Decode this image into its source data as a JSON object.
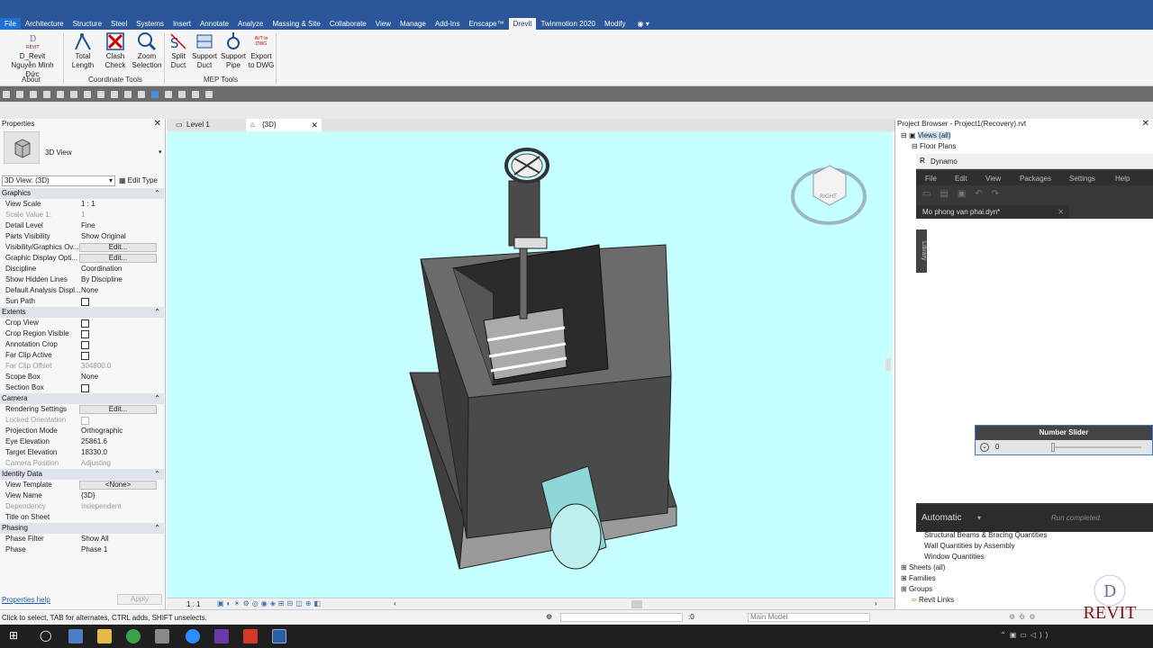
{
  "menu": {
    "tabs": [
      "File",
      "Architecture",
      "Structure",
      "Steel",
      "Systems",
      "Insert",
      "Annotate",
      "Analyze",
      "Massing & Site",
      "Collaborate",
      "View",
      "Manage",
      "Add-Ins",
      "Enscape™",
      "Drevit",
      "Twinmotion 2020",
      "Modify"
    ]
  },
  "ribbon": {
    "about": {
      "top": "D_Revit",
      "name": "Nguyễn Minh Đức",
      "panel": "About"
    },
    "coord": {
      "total_length": [
        "Total",
        "Length"
      ],
      "clash_check": [
        "Clash",
        "Check"
      ],
      "zoom_selection": [
        "Zoom",
        "Selection"
      ],
      "panel": "Coordinate Tools"
    },
    "mep": {
      "split_duct": [
        "Split",
        "Duct"
      ],
      "support_duct": [
        "Support",
        "Duct"
      ],
      "support_pipe": [
        "Support",
        "Pipe"
      ],
      "export_dwg": [
        "Export",
        "to DWG"
      ],
      "export_icon_text": "AVT to DWG",
      "panel": "MEP Tools"
    }
  },
  "properties": {
    "title": "Properties",
    "type_name": "3D View",
    "selector": "3D View: (3D)",
    "edit_type": "Edit Type",
    "groups": {
      "graphics": "Graphics",
      "extents": "Extents",
      "camera": "Camera",
      "identity": "Identity Data",
      "phasing": "Phasing"
    },
    "rows": {
      "view_scale": [
        "View Scale",
        "1 : 1"
      ],
      "scale_value": [
        "Scale Value    1:",
        "1"
      ],
      "detail_level": [
        "Detail Level",
        "Fine"
      ],
      "parts_visibility": [
        "Parts Visibility",
        "Show Original"
      ],
      "vg": [
        "Visibility/Graphics Ov...",
        "Edit..."
      ],
      "gdo": [
        "Graphic Display Opti...",
        "Edit..."
      ],
      "discipline": [
        "Discipline",
        "Coordination"
      ],
      "hidden_lines": [
        "Show Hidden Lines",
        "By Discipline"
      ],
      "analysis": [
        "Default Analysis Displ...",
        "None"
      ],
      "sun_path": [
        "Sun Path",
        ""
      ],
      "crop_view": [
        "Crop View",
        ""
      ],
      "crop_region": [
        "Crop Region Visible",
        ""
      ],
      "anno_crop": [
        "Annotation Crop",
        ""
      ],
      "far_clip": [
        "Far Clip Active",
        ""
      ],
      "far_clip_offset": [
        "Far Clip Offset",
        "304800.0"
      ],
      "scope_box": [
        "Scope Box",
        "None"
      ],
      "section_box": [
        "Section Box",
        ""
      ],
      "rendering": [
        "Rendering Settings",
        "Edit..."
      ],
      "locked": [
        "Locked Orientation",
        ""
      ],
      "projection": [
        "Projection Mode",
        "Orthographic"
      ],
      "eye": [
        "Eye Elevation",
        "25861.6"
      ],
      "target": [
        "Target Elevation",
        "18330.0"
      ],
      "cam_pos": [
        "Camera Position",
        "Adjusting"
      ],
      "view_template": [
        "View Template",
        "<None>"
      ],
      "view_name": [
        "View Name",
        "{3D}"
      ],
      "dependency": [
        "Dependency",
        "Independent"
      ],
      "title_sheet": [
        "Title on Sheet",
        ""
      ],
      "phase_filter": [
        "Phase Filter",
        "Show All"
      ],
      "phase": [
        "Phase",
        "Phase 1"
      ]
    },
    "help": "Properties help",
    "apply": "Apply"
  },
  "views": {
    "tab1": "Level 1",
    "tab2": "{3D}",
    "scale": "1 : 1",
    "viewcube": "RIGHT"
  },
  "browser": {
    "title": "Project Browser - Project1(Recovery).rvt",
    "views_all": "Views (all)",
    "floor_plans": "Floor Plans",
    "struct_beams": "Structural Beams & Bracing Quantities",
    "wall_q": "Wall Quantities by Assembly",
    "window_q": "Window Quantities",
    "sheets": "Sheets (all)",
    "families": "Families",
    "groups": "Groups",
    "links": "Revit Links"
  },
  "dynamo": {
    "title": "Dynamo",
    "menu": [
      "File",
      "Edit",
      "View",
      "Packages",
      "Settings",
      "Help"
    ],
    "file_tab": "Mo phong van phai.dyn*",
    "library": "Library",
    "node_title": "Number Slider",
    "slider_value": "0",
    "run_mode": "Automatic",
    "run_status": "Run completed."
  },
  "status": {
    "hint": "Click to select, TAB for alternates, CTRL adds, SHIFT unselects.",
    "coord": ":0",
    "model": "Main Model"
  },
  "watermark": "REVIT",
  "colors": {
    "accent": "#2b579a",
    "canvas": "#c5ffff"
  }
}
